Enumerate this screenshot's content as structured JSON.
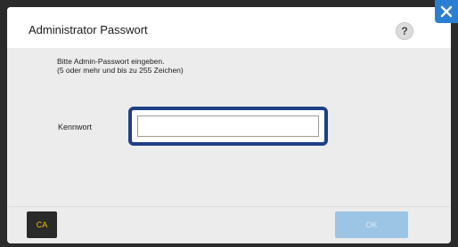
{
  "dialog": {
    "title": "Administrator Passwort",
    "help_label": "?",
    "close_icon": "close-x-icon"
  },
  "instructions": {
    "line1": "Bitte Admin-Passwort eingeben.",
    "line2": "(5 oder mehr und bis zu 255 Zeichen)"
  },
  "password_field": {
    "label": "Kennwort",
    "value": "",
    "placeholder": ""
  },
  "buttons": {
    "ca_label": "CA",
    "ok_label": "OK"
  },
  "colors": {
    "accent_blue": "#2a7fd4",
    "focus_border": "#1f3f86",
    "ca_text": "#f2c200",
    "ok_disabled": "#9cc4e4"
  }
}
